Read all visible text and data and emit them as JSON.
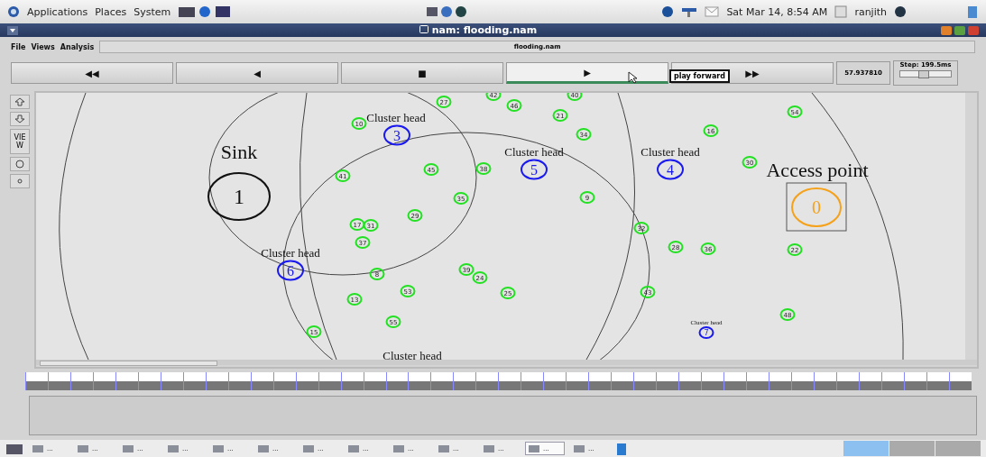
{
  "top_panel": {
    "menus": [
      "Applications",
      "Places",
      "System"
    ],
    "clock": "Sat Mar 14,  8:54 AM",
    "user": "ranjith"
  },
  "window": {
    "title": "nam: flooding.nam"
  },
  "menu_bar": {
    "items": [
      "File",
      "Views",
      "Analysis"
    ],
    "file_name": "flooding.nam"
  },
  "controls": {
    "buttons": [
      {
        "symbol": "◀◀",
        "selected": false
      },
      {
        "symbol": "◀",
        "selected": false
      },
      {
        "symbol": "■",
        "selected": false
      },
      {
        "symbol": "▶",
        "selected": true
      },
      {
        "symbol": "▶▶",
        "selected": false
      }
    ],
    "tooltip": "play forward",
    "time": "57.937810",
    "step": "Step: 199.5ms",
    "step_slider": {
      "level": 0.45
    }
  },
  "side_tools": {
    "view_label": "VIEW"
  },
  "canvas": {
    "nodes": [
      {
        "label": "27",
        "kind": "sensor"
      },
      {
        "label": "42",
        "kind": "sensor"
      },
      {
        "label": "46",
        "kind": "sensor"
      },
      {
        "label": "40",
        "kind": "sensor"
      },
      {
        "label": "21",
        "kind": "sensor"
      },
      {
        "label": "34",
        "kind": "sensor"
      },
      {
        "label": "16",
        "kind": "sensor"
      },
      {
        "label": "54",
        "kind": "sensor"
      },
      {
        "label": "10",
        "kind": "sensor"
      },
      {
        "label": "30",
        "kind": "sensor"
      },
      {
        "label": "41",
        "kind": "sensor"
      },
      {
        "label": "45",
        "kind": "sensor"
      },
      {
        "label": "38",
        "kind": "sensor"
      },
      {
        "label": "35",
        "kind": "sensor"
      },
      {
        "label": "9",
        "kind": "sensor"
      },
      {
        "label": "29",
        "kind": "sensor"
      },
      {
        "label": "17",
        "kind": "sensor"
      },
      {
        "label": "31",
        "kind": "sensor"
      },
      {
        "label": "37",
        "kind": "sensor"
      },
      {
        "label": "32",
        "kind": "sensor"
      },
      {
        "label": "28",
        "kind": "sensor"
      },
      {
        "label": "36",
        "kind": "sensor"
      },
      {
        "label": "22",
        "kind": "sensor"
      },
      {
        "label": "8",
        "kind": "sensor"
      },
      {
        "label": "39",
        "kind": "sensor"
      },
      {
        "label": "24",
        "kind": "sensor"
      },
      {
        "label": "53",
        "kind": "sensor"
      },
      {
        "label": "25",
        "kind": "sensor"
      },
      {
        "label": "43",
        "kind": "sensor"
      },
      {
        "label": "13",
        "kind": "sensor"
      },
      {
        "label": "55",
        "kind": "sensor"
      },
      {
        "label": "15",
        "kind": "sensor"
      },
      {
        "label": "48",
        "kind": "sensor"
      },
      {
        "label": "3",
        "kind": "cluster_head"
      },
      {
        "label": "5",
        "kind": "cluster_head"
      },
      {
        "label": "4",
        "kind": "cluster_head"
      },
      {
        "label": "6",
        "kind": "cluster_head"
      },
      {
        "label": "7",
        "kind": "small_cluster_head"
      },
      {
        "label": "1",
        "kind": "sink"
      },
      {
        "label": "0",
        "kind": "access_point"
      }
    ],
    "annotations": [
      {
        "text": "Cluster head",
        "kind": "normal"
      },
      {
        "text": "Cluster head",
        "kind": "normal"
      },
      {
        "text": "Cluster head",
        "kind": "normal"
      },
      {
        "text": "Cluster head",
        "kind": "normal"
      },
      {
        "text": "Cluster head",
        "kind": "normal"
      },
      {
        "text": "Sink",
        "kind": "large"
      },
      {
        "text": "Access point",
        "kind": "large"
      },
      {
        "text": "Cluster head",
        "kind": "tiny"
      }
    ]
  },
  "taskbar": {
    "items": [
      {
        "label": "...",
        "selected": false
      },
      {
        "label": "...",
        "selected": false
      },
      {
        "label": "...",
        "selected": false
      },
      {
        "label": "...",
        "selected": false
      },
      {
        "label": "...",
        "selected": false
      },
      {
        "label": "...",
        "selected": false
      },
      {
        "label": "...",
        "selected": false
      },
      {
        "label": "...",
        "selected": false
      },
      {
        "label": "...",
        "selected": false
      },
      {
        "label": "...",
        "selected": false
      },
      {
        "label": "...",
        "selected": false
      },
      {
        "label": "...",
        "selected": true
      },
      {
        "label": "...",
        "selected": false
      }
    ]
  }
}
